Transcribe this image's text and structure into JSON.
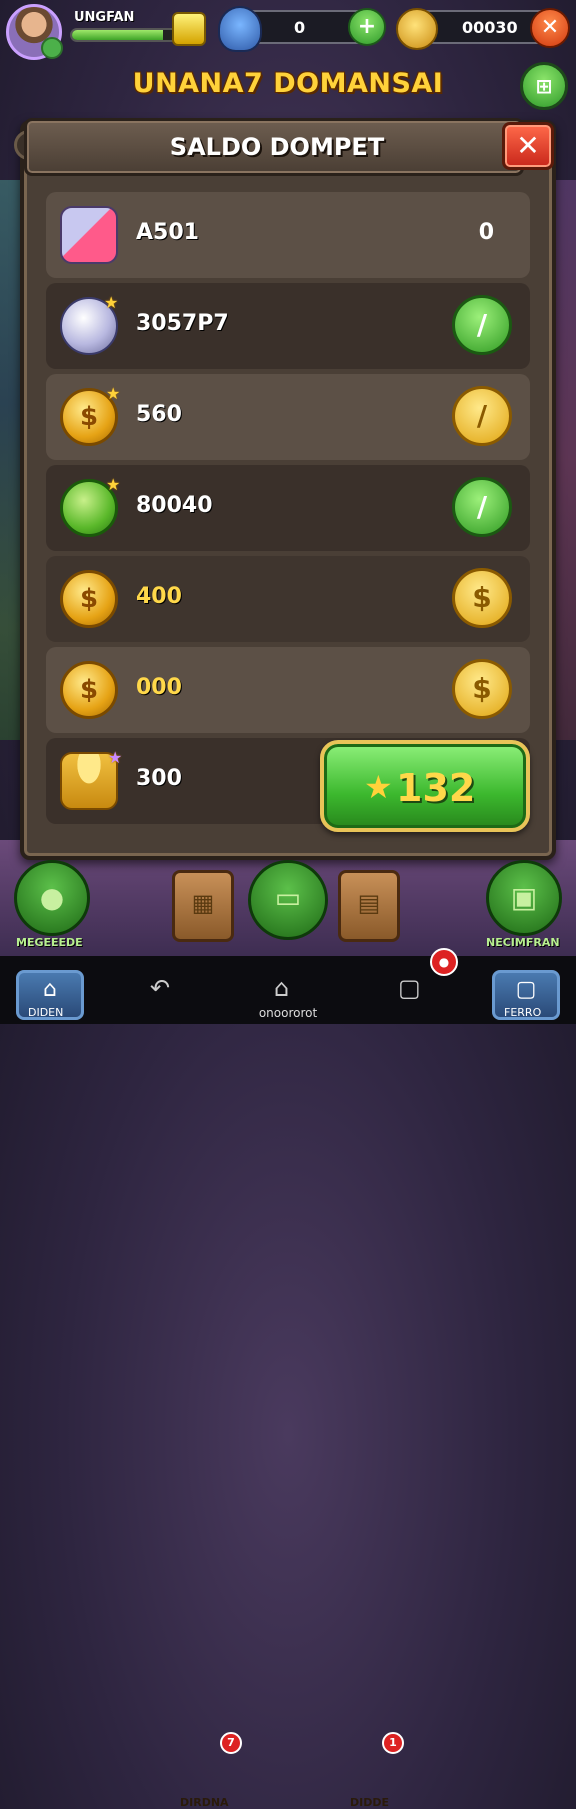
{
  "top_bar": {
    "player_name": "UNGFAN",
    "xp_progress": 0.72,
    "resource_1_value": "0",
    "resource_1_add": "+",
    "resource_2_value": "00030",
    "close": "✕"
  },
  "game_title": "UNANA7 DOMANSAI",
  "side_button": "⊞",
  "panel": {
    "title": "SALDO DOMPET",
    "close": "✕",
    "rows": [
      {
        "icon": "gift-gems-icon",
        "label": "A501",
        "right_text": "0"
      },
      {
        "icon": "silver-coins-icon",
        "label": "3057P7",
        "button": "/",
        "button_style": "green"
      },
      {
        "icon": "gold-coin-icon",
        "label": "560",
        "button": "/",
        "button_style": "gold"
      },
      {
        "icon": "green-coin-icon",
        "label": "80040",
        "button": "/",
        "button_style": "green"
      },
      {
        "icon": "gold-coin-icon",
        "label": "400",
        "button": "$",
        "button_style": "gold"
      },
      {
        "icon": "gold-coin-icon",
        "label": "000",
        "button": "$",
        "button_style": "gold"
      },
      {
        "icon": "coin-stack-icon",
        "label": "300"
      }
    ],
    "claim_button_value": "132"
  },
  "bottom_nav": {
    "item_1": "MEGEEEDE",
    "item_2": "DIRDNA",
    "item_3_badge": "7",
    "item_4": "DIDDE",
    "item_4_badge": "1",
    "item_5": "NECIMFRAN"
  },
  "system_bar": {
    "left_label": "DIDEN",
    "right_label": "FERRO",
    "center_label": "onoororot",
    "notification_badge": "●"
  },
  "colors": {
    "accent_gold": "#ffd23a",
    "accent_green": "#3cb82e",
    "panel_bg": "#4a3f36",
    "close_red": "#d23a10"
  }
}
